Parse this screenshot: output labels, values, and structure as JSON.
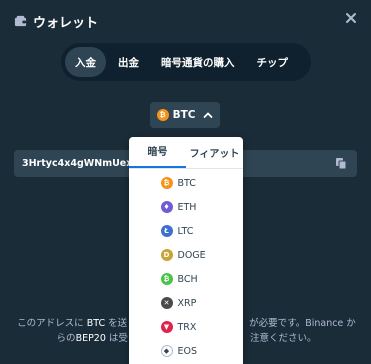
{
  "header": {
    "title": "ウォレット"
  },
  "tabs": [
    {
      "label": "入金",
      "active": true
    },
    {
      "label": "出金",
      "active": false
    },
    {
      "label": "暗号通貨の購入",
      "active": false
    },
    {
      "label": "チップ",
      "active": false
    }
  ],
  "currency_select": {
    "selected": "BTC",
    "icon": "btc-coin-icon",
    "color": "#f7931a"
  },
  "address": {
    "value": "3Hrtyc4x4gWNmUexBt"
  },
  "notice": {
    "prefix": "このアドレスに ",
    "currency": "BTC",
    "middle": " を送",
    "suffix": "が必要です。Binance か",
    "line2a": "らの",
    "network": "BEP20",
    "line2b": " は受",
    "line2c": "注意ください。"
  },
  "dropdown": {
    "tabs": [
      {
        "label": "暗号",
        "active": true
      },
      {
        "label": "フィアット",
        "active": false
      }
    ],
    "items": [
      {
        "name": "BTC",
        "icon": "btc-coin-icon",
        "color": "#f7931a",
        "glyph": "₿"
      },
      {
        "name": "ETH",
        "icon": "eth-coin-icon",
        "color": "#6f5bd6",
        "glyph": "♦"
      },
      {
        "name": "LTC",
        "icon": "ltc-coin-icon",
        "color": "#3f6fcf",
        "glyph": "Ł"
      },
      {
        "name": "DOGE",
        "icon": "doge-coin-icon",
        "color": "#c8a337",
        "glyph": "D"
      },
      {
        "name": "BCH",
        "icon": "bch-coin-icon",
        "color": "#4cc24a",
        "glyph": "₿"
      },
      {
        "name": "XRP",
        "icon": "xrp-coin-icon",
        "color": "#4a4a4a",
        "glyph": "✕"
      },
      {
        "name": "TRX",
        "icon": "trx-coin-icon",
        "color": "#e0234a",
        "glyph": "▼"
      },
      {
        "name": "EOS",
        "icon": "eos-coin-icon",
        "color": "#ffffff",
        "glyph": "◆"
      }
    ]
  }
}
